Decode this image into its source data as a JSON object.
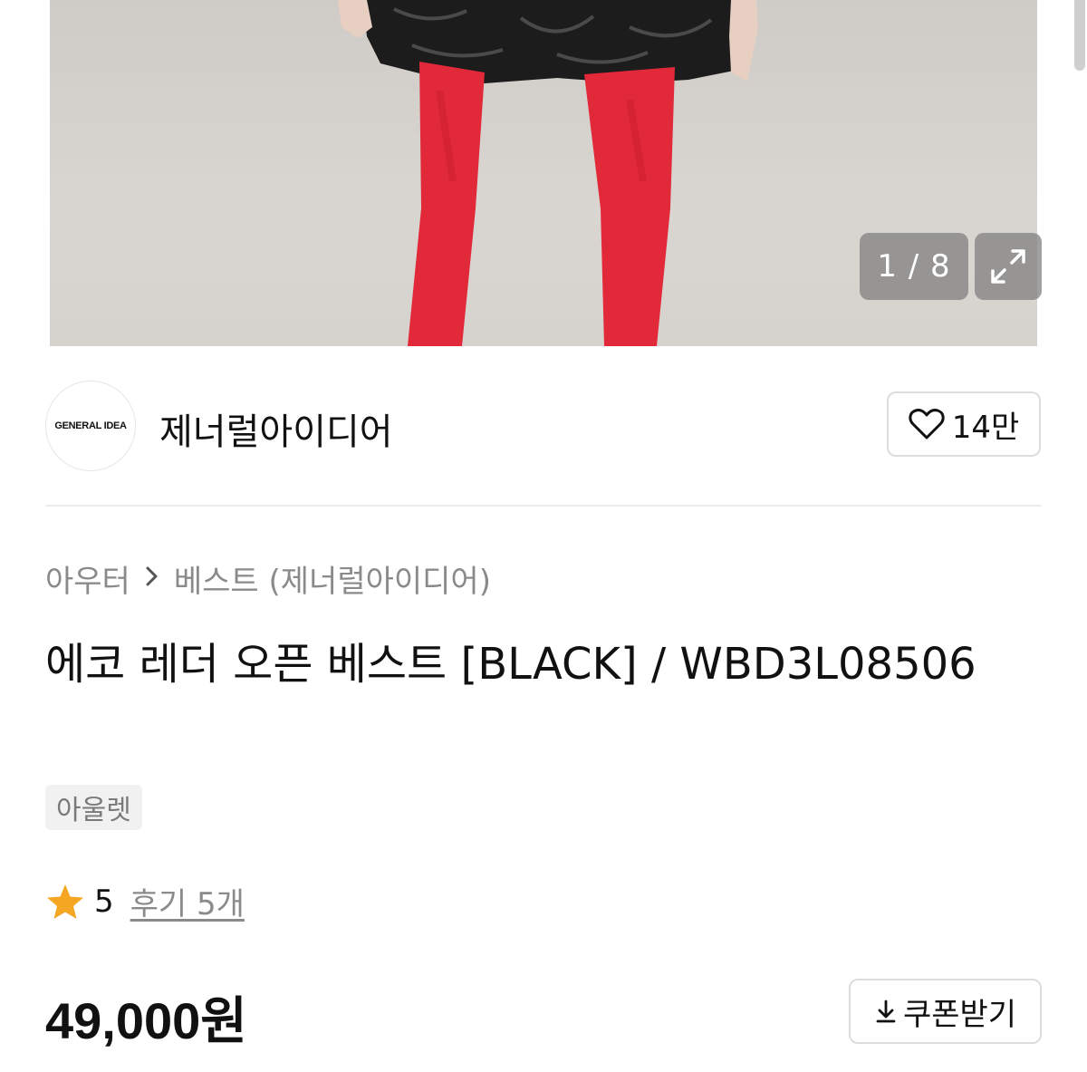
{
  "gallery": {
    "pager_text": "1 / 8",
    "expand_icon": "expand-icon"
  },
  "brand": {
    "logo_text": "GENERAL IDEA",
    "name": "제너럴아이디어",
    "like_icon": "heart-icon",
    "like_count": "14만"
  },
  "breadcrumb": {
    "category": "아우터",
    "separator_icon": "chevron-right-icon",
    "subcategory": "베스트 (제너럴아이디어)"
  },
  "product": {
    "title": "에코 레더 오픈 베스트 [BLACK] / WBD3L08506",
    "tag": "아울렛",
    "rating_icon": "star-icon",
    "rating": "5",
    "review_link": "후기 5개",
    "price": "49,000원",
    "coupon_icon": "download-icon",
    "coupon_label": "쿠폰받기"
  },
  "colors": {
    "star": "#F5A623",
    "overlay": "#808080"
  }
}
